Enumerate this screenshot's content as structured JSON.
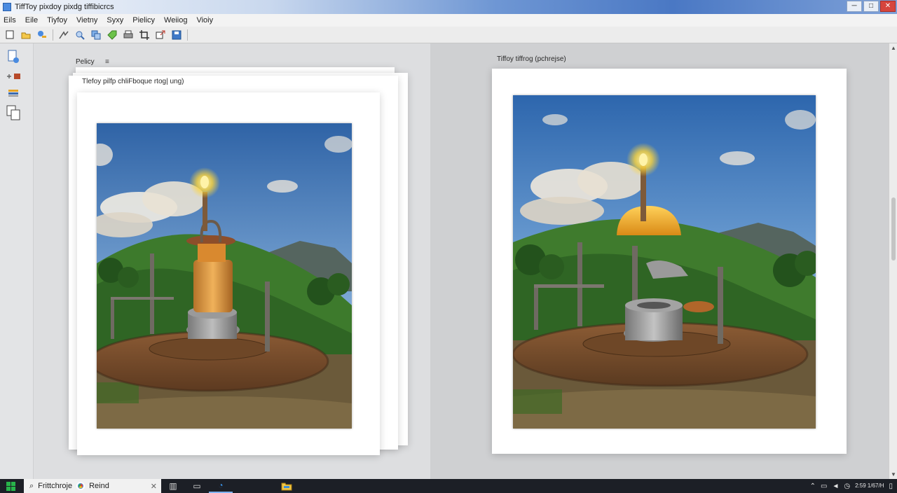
{
  "window": {
    "title": "TiffToy pixdoy pixdg tiffibicrcs",
    "controls": [
      "─",
      "□",
      "✕"
    ]
  },
  "menu": [
    "Eils",
    "Eile",
    "Tiyfoy",
    "Vietny",
    "Syxy",
    "Pielicy",
    "Weiiog",
    "Vioiy"
  ],
  "left_panel": {
    "label": "Pelicy",
    "pin": "≡",
    "caption": "Tlefoy pilfp chliFboque rtog| ung)"
  },
  "right_panel": {
    "label": "Tiffoy tiffrog (pchrejse)"
  },
  "taskbar": {
    "search_text": "Frittchroje",
    "browser_label": "Reind",
    "clock": "2:59 1/67/H"
  },
  "colors": {
    "titlebar_accent": "#4a78c4",
    "sky_top": "#3a6fb2",
    "hill_green": "#3d7a2c",
    "flame": "#ffe46b",
    "taskbar_bg": "#1c1f26"
  },
  "icons": {
    "toolbar": [
      "new-file-icon",
      "open-folder-icon",
      "brush-icon",
      "arrow-icon",
      "zoom-icon",
      "layers-icon",
      "tag-icon",
      "print-icon",
      "crop-icon",
      "export-icon",
      "save-icon"
    ],
    "left_strip": [
      "page-add-icon",
      "pointer-icon",
      "color-swatch-icon",
      "copy-pages-icon"
    ]
  }
}
